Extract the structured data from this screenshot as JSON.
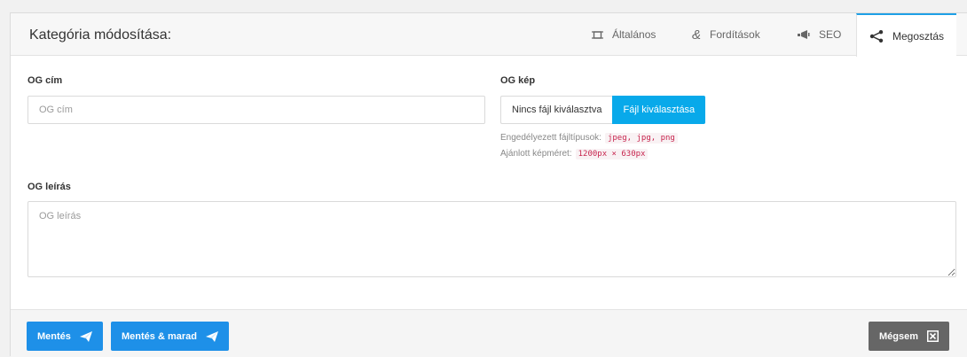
{
  "header": {
    "title": "Kategória módosítása:",
    "tabs": [
      {
        "label": "Általános",
        "icon": "frame-icon"
      },
      {
        "label": "Fordítások",
        "icon": "ampersand-icon"
      },
      {
        "label": "SEO",
        "icon": "megaphone-icon"
      },
      {
        "label": "Megosztás",
        "icon": "share-icon",
        "active": true
      }
    ]
  },
  "form": {
    "og_title": {
      "label": "OG cím",
      "placeholder": "OG cím",
      "value": ""
    },
    "og_image": {
      "label": "OG kép",
      "file_name": "Nincs fájl kiválasztva",
      "choose_label": "Fájl kiválasztása",
      "allowed_label": "Engedélyezett fájltípusok:",
      "allowed_types": "jpeg, jpg, png",
      "recommended_label": "Ajánlott képméret:",
      "recommended_size": "1200px × 630px"
    },
    "og_description": {
      "label": "OG leírás",
      "placeholder": "OG leírás",
      "value": ""
    }
  },
  "footer": {
    "save_label": "Mentés",
    "save_stay_label": "Mentés & marad",
    "cancel_label": "Mégsem"
  },
  "colors": {
    "accent": "#1ea0e6",
    "primary_button": "#1e90e8",
    "file_button": "#08a9ea",
    "cancel_button": "#666666",
    "code_text": "#c7254e"
  }
}
